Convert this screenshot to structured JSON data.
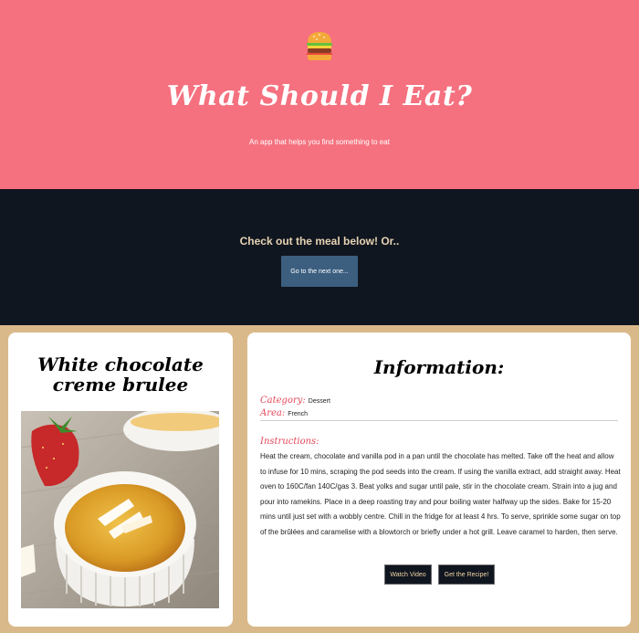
{
  "hero": {
    "icon": "burger-icon",
    "title": "What Should I Eat?",
    "subtitle": "An app that helps you find something to eat"
  },
  "cta": {
    "text": "Check out the meal below! Or..",
    "next_button": "Go to the next one..."
  },
  "meal": {
    "name": "White chocolate creme brulee",
    "photo": "creme-brulee-photo"
  },
  "info": {
    "heading": "Information:",
    "category_label": "Category:",
    "category_value": "Dessert",
    "area_label": "Area:",
    "area_value": "French",
    "instructions_label": "Instructions:",
    "instructions": "Heat the cream, chocolate and vanilla pod in a pan until the chocolate has melted. Take off the heat and allow to infuse for 10 mins, scraping the pod seeds into the cream. If using the vanilla extract, add straight away. Heat oven to 160C/fan 140C/gas 3. Beat yolks and sugar until pale, stir in the chocolate cream. Strain into a jug and pour into ramekins. Place in a deep roasting tray and pour boiling water halfway up the sides. Bake for 15-20 mins until just set with a wobbly centre. Chill in the fridge for at least 4 hrs. To serve, sprinkle some sugar on top of the brûlées and caramelise with a blowtorch or briefly under a hot grill. Leave caramel to harden, then serve.",
    "watch_button": "Watch Video",
    "recipe_button": "Get the Recipe!"
  },
  "colors": {
    "hero_bg": "#f5717f",
    "cta_bg": "#101620",
    "page_bg": "#d9b98a",
    "accent_label": "#e4485a",
    "next_button_bg": "#3c5f80"
  }
}
